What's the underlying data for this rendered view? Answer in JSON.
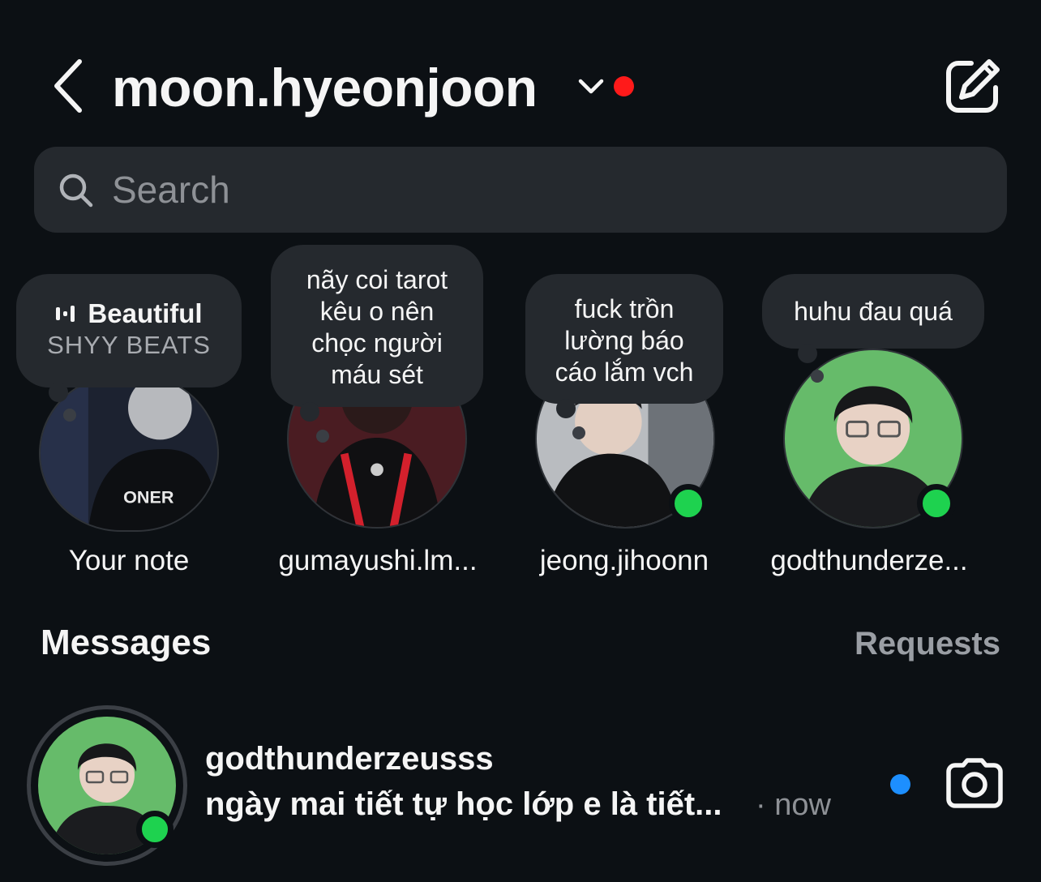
{
  "header": {
    "account_name": "moon.hyeonjoon",
    "unread_indicator_color": "#ff1a1a"
  },
  "search": {
    "placeholder": "Search"
  },
  "notes": [
    {
      "type": "music",
      "song": "Beautiful",
      "artist": "SHYY BEATS",
      "label": "Your note",
      "online": false
    },
    {
      "type": "text",
      "text_lines": [
        "nãy coi tarot",
        "kêu o nên",
        "chọc người",
        "máu sét"
      ],
      "label": "gumayushi.lm...",
      "online": false
    },
    {
      "type": "text",
      "text_lines": [
        "fuck trồn",
        "lường báo",
        "cáo lắm vch"
      ],
      "label": "jeong.jihoonn",
      "online": true
    },
    {
      "type": "text",
      "text_lines": [
        "huhu đau quá"
      ],
      "label": "godthunderze...",
      "online": true
    }
  ],
  "messages": {
    "title": "Messages",
    "requests_label": "Requests",
    "threads": [
      {
        "username": "godthunderzeusss",
        "preview": "ngày mai tiết tự học lớp e là tiết...",
        "time": "· now",
        "unread": true,
        "online": true
      }
    ]
  },
  "colors": {
    "background": "#0c1014",
    "surface": "#25292e",
    "online": "#1ed24f",
    "unread_blue": "#1d8fff"
  },
  "icons": [
    "back-icon",
    "chevron-down-icon",
    "compose-icon",
    "search-icon",
    "music-bars-icon",
    "camera-icon"
  ]
}
